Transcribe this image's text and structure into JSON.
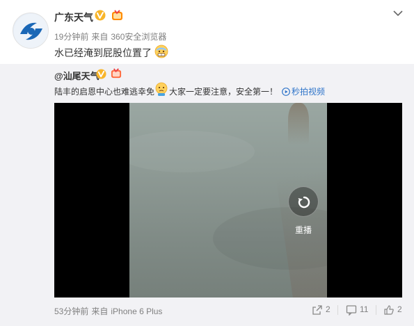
{
  "post": {
    "author": "广东天气",
    "time": "19分钟前",
    "from_label": "来自",
    "source": "360安全浏览器",
    "text": "水已经淹到屁股位置了",
    "emoji_icon": "grimace-sweat-emoji-icon"
  },
  "repost": {
    "author": "@汕尾天气",
    "text_before": "陆丰的启恩中心也难逃幸免",
    "emoji_icon": "worried-emoji-icon",
    "text_after": "大家一定要注意，安全第一！",
    "video_link": "秒拍视频",
    "video": {
      "replay_label": "重播"
    },
    "time": "53分钟前",
    "from_label": "来自",
    "source": "iPhone 6 Plus",
    "actions": {
      "share_count": "2",
      "comment_count": "11",
      "like_count": "2"
    }
  },
  "colors": {
    "link": "#2e74c9",
    "verified_badge": "#f8b52a",
    "repost_background": "#f2f2f5"
  }
}
